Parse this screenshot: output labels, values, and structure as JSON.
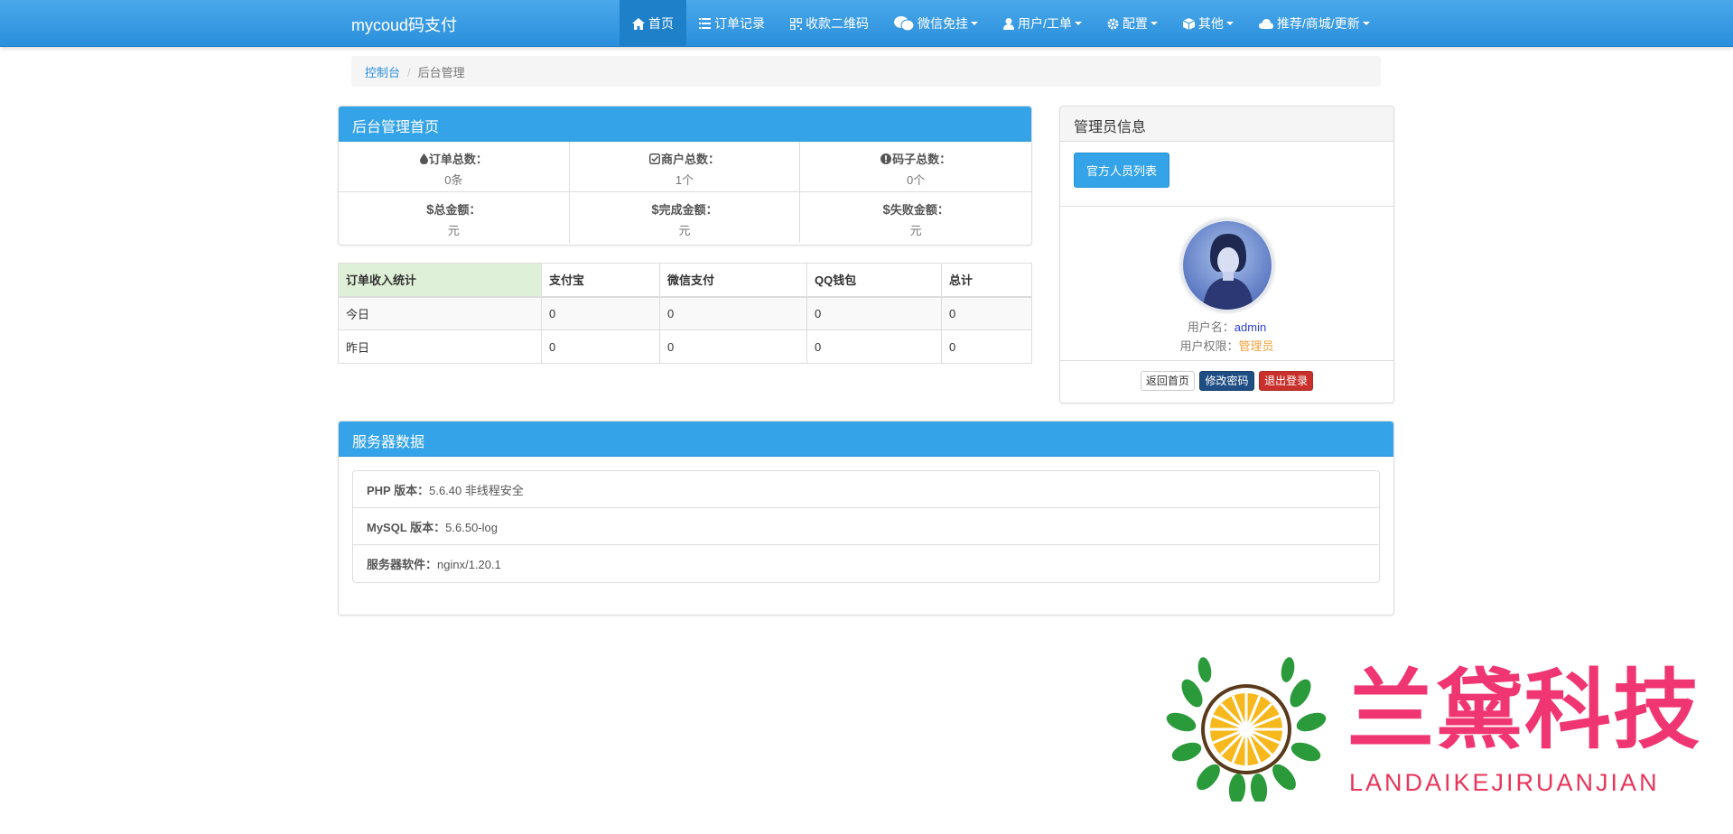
{
  "brand": "mycoud码支付",
  "nav": [
    {
      "label": "首页",
      "icon": "home-icon",
      "active": true,
      "dropdown": false
    },
    {
      "label": "订单记录",
      "icon": "list-icon",
      "active": false,
      "dropdown": false
    },
    {
      "label": "收款二维码",
      "icon": "qrcode-icon",
      "active": false,
      "dropdown": false
    },
    {
      "label": "微信免挂",
      "icon": "wechat-icon",
      "active": false,
      "dropdown": true
    },
    {
      "label": "用户/工单",
      "icon": "user-icon",
      "active": false,
      "dropdown": true
    },
    {
      "label": "配置",
      "icon": "gear-icon",
      "active": false,
      "dropdown": true
    },
    {
      "label": "其他",
      "icon": "cube-icon",
      "active": false,
      "dropdown": true
    },
    {
      "label": "推荐/商城/更新",
      "icon": "cloud-icon",
      "active": false,
      "dropdown": true
    }
  ],
  "breadcrumb": {
    "link": "控制台",
    "active": "后台管理"
  },
  "dashboard": {
    "title": "后台管理首页",
    "stats": [
      {
        "label": "订单总数：",
        "value": "0条",
        "icon": "drop-icon"
      },
      {
        "label": "商户总数：",
        "value": "1个",
        "icon": "check-square-icon"
      },
      {
        "label": "码子总数：",
        "value": "0个",
        "icon": "info-circle-icon"
      },
      {
        "label": "总金额：",
        "value": "元",
        "icon": "dollar-icon"
      },
      {
        "label": "完成金额：",
        "value": "元",
        "icon": "dollar-icon"
      },
      {
        "label": "失败金额：",
        "value": "元",
        "icon": "dollar-icon"
      }
    ]
  },
  "income_table": {
    "headers": [
      "订单收入统计",
      "支付宝",
      "微信支付",
      "QQ钱包",
      "总计"
    ],
    "rows": [
      [
        "今日",
        "0",
        "0",
        "0",
        "0"
      ],
      [
        "昨日",
        "0",
        "0",
        "0",
        "0"
      ]
    ]
  },
  "admin": {
    "title": "管理员信息",
    "staff_button": "官方人员列表",
    "username_label": "用户名：",
    "username": "admin",
    "role_label": "用户权限：",
    "role": "管理员",
    "buttons": {
      "home": "返回首页",
      "password": "修改密码",
      "logout": "退出登录"
    }
  },
  "server": {
    "title": "服务器数据",
    "items": [
      {
        "label": "PHP 版本：",
        "value": "5.6.40 非线程安全"
      },
      {
        "label": "MySQL 版本：",
        "value": "5.6.50-log"
      },
      {
        "label": "服务器软件：",
        "value": "nginx/1.20.1"
      }
    ]
  },
  "watermark": {
    "title": "兰黛科技",
    "subtitle": "LANDAIKEJIRUANJIAN"
  },
  "colors": {
    "primary": "#34a3e8",
    "navbar": "#2a8fdc",
    "danger": "#c9302c",
    "role": "#f0a23c",
    "watermark": "#f03672"
  }
}
